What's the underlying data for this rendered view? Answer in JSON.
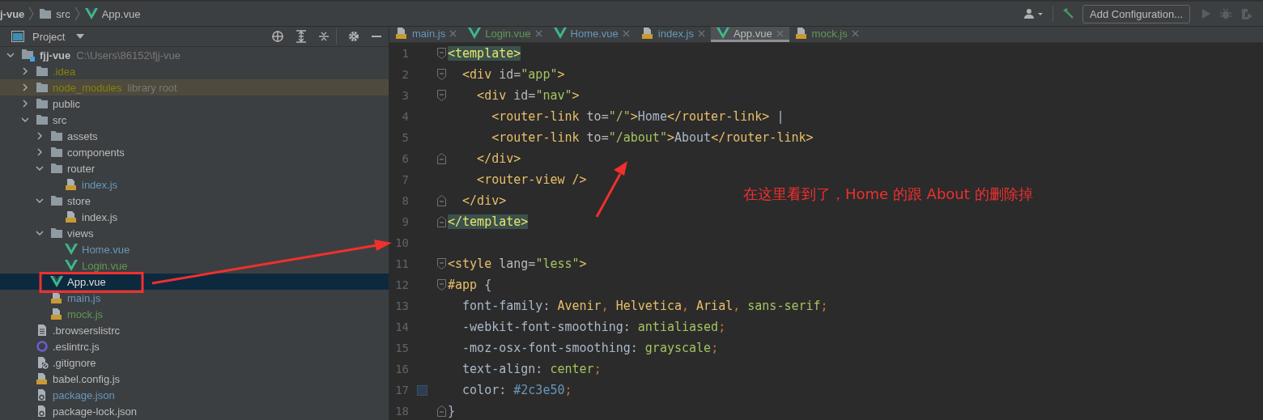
{
  "breadcrumb": [
    {
      "name": "j-vue",
      "kind": "project"
    },
    {
      "name": "src",
      "kind": "folder"
    },
    {
      "name": "App.vue",
      "kind": "vue"
    }
  ],
  "toolbar": {
    "run_configuration": "Add Configuration..."
  },
  "project_panel": {
    "title": "Project"
  },
  "tree": [
    {
      "name": "fjj-vue",
      "hint": "C:\\Users\\86152\\fjj-vue",
      "kind": "module",
      "color": "#bbbbbb",
      "selected": false,
      "library": false,
      "expanded": true,
      "children": [
        {
          "name": ".idea",
          "kind": "folder",
          "color": "#848504",
          "selected": false,
          "library": false,
          "expanded": false
        },
        {
          "name": "node_modules",
          "hint": "library root",
          "kind": "folder",
          "color": "#848504",
          "selected": false,
          "library": true,
          "expanded": false
        },
        {
          "name": "public",
          "kind": "folder",
          "color": "#bbbbbb",
          "selected": false,
          "library": false,
          "expanded": false
        },
        {
          "name": "src",
          "kind": "folder",
          "color": "#bbbbbb",
          "selected": false,
          "library": false,
          "expanded": true,
          "children": [
            {
              "name": "assets",
              "kind": "folder",
              "color": "#bbbbbb",
              "selected": false,
              "library": false,
              "expanded": false
            },
            {
              "name": "components",
              "kind": "folder",
              "color": "#bbbbbb",
              "selected": false,
              "library": false,
              "expanded": false
            },
            {
              "name": "router",
              "kind": "folder",
              "color": "#bbbbbb",
              "selected": false,
              "library": false,
              "expanded": true,
              "children": [
                {
                  "name": "index.js",
                  "kind": "js",
                  "color": "#6897bb",
                  "selected": false,
                  "library": false
                }
              ]
            },
            {
              "name": "store",
              "kind": "folder",
              "color": "#bbbbbb",
              "selected": false,
              "library": false,
              "expanded": true,
              "children": [
                {
                  "name": "index.js",
                  "kind": "js",
                  "color": "#bbbbbb",
                  "selected": false,
                  "library": false
                }
              ]
            },
            {
              "name": "views",
              "kind": "folder",
              "color": "#bbbbbb",
              "selected": false,
              "library": false,
              "expanded": true,
              "children": [
                {
                  "name": "Home.vue",
                  "kind": "vue",
                  "color": "#6897bb",
                  "selected": false,
                  "library": false
                },
                {
                  "name": "Login.vue",
                  "kind": "vue",
                  "color": "#629755",
                  "selected": false,
                  "library": false
                }
              ]
            },
            {
              "name": "App.vue",
              "kind": "vue",
              "color": "#dddddd",
              "selected": true,
              "library": false
            },
            {
              "name": "main.js",
              "kind": "js",
              "color": "#6897bb",
              "selected": false,
              "library": false
            },
            {
              "name": "mock.js",
              "kind": "js",
              "color": "#629755",
              "selected": false,
              "library": false
            }
          ]
        },
        {
          "name": ".browserslistrc",
          "kind": "text",
          "color": "#bbbbbb",
          "selected": false,
          "library": false
        },
        {
          "name": ".eslintrc.js",
          "kind": "eslint",
          "color": "#bbbbbb",
          "selected": false,
          "library": false
        },
        {
          "name": ".gitignore",
          "kind": "gitignore",
          "color": "#bbbbbb",
          "selected": false,
          "library": false
        },
        {
          "name": "babel.config.js",
          "kind": "js",
          "color": "#bbbbbb",
          "selected": false,
          "library": false
        },
        {
          "name": "package.json",
          "kind": "json",
          "color": "#6897bb",
          "selected": false,
          "library": false
        },
        {
          "name": "package-lock.json",
          "kind": "json",
          "color": "#bbbbbb",
          "selected": false,
          "library": false
        }
      ]
    }
  ],
  "tabs": [
    {
      "name": "main.js",
      "kind": "js",
      "color": "#6897bb",
      "selected": false
    },
    {
      "name": "Login.vue",
      "kind": "vue",
      "color": "#629755",
      "selected": false
    },
    {
      "name": "Home.vue",
      "kind": "vue",
      "color": "#6897bb",
      "selected": false
    },
    {
      "name": "index.js",
      "kind": "js",
      "color": "#6897bb",
      "selected": false
    },
    {
      "name": "App.vue",
      "kind": "vue",
      "color": "#bbbbbb",
      "selected": true
    },
    {
      "name": "mock.js",
      "kind": "js",
      "color": "#629755",
      "selected": false
    }
  ],
  "code": [
    {
      "number": "1",
      "kind": "fold-open",
      "tokens": [
        {
          "kind": "match",
          "t": "<template>"
        }
      ]
    },
    {
      "number": "2",
      "kind": "fold-open",
      "tokens": [
        {
          "kind": "tag",
          "t": "  <div"
        },
        {
          "kind": "attr",
          "t": " id="
        },
        {
          "kind": "string",
          "t": "\"app\""
        },
        {
          "kind": "tag",
          "t": ">"
        }
      ]
    },
    {
      "number": "3",
      "kind": "fold-open",
      "tokens": [
        {
          "kind": "tag",
          "t": "    <div"
        },
        {
          "kind": "attr",
          "t": " id="
        },
        {
          "kind": "string",
          "t": "\"nav\""
        },
        {
          "kind": "tag",
          "t": ">"
        }
      ]
    },
    {
      "number": "4",
      "kind": "plain",
      "tokens": [
        {
          "kind": "tag",
          "t": "      <router-link"
        },
        {
          "kind": "attr",
          "t": " to="
        },
        {
          "kind": "string",
          "t": "\"/\""
        },
        {
          "kind": "tag",
          "t": ">"
        },
        {
          "kind": "text",
          "t": "Home"
        },
        {
          "kind": "tag",
          "t": "</router-link>"
        },
        {
          "kind": "text",
          "t": " |"
        }
      ]
    },
    {
      "number": "5",
      "kind": "plain",
      "tokens": [
        {
          "kind": "tag",
          "t": "      <router-link"
        },
        {
          "kind": "attr",
          "t": " to="
        },
        {
          "kind": "string",
          "t": "\"/about\""
        },
        {
          "kind": "tag",
          "t": ">"
        },
        {
          "kind": "text",
          "t": "About"
        },
        {
          "kind": "tag",
          "t": "</router-link>"
        }
      ]
    },
    {
      "number": "6",
      "kind": "fold-close",
      "tokens": [
        {
          "kind": "tag",
          "t": "    </div>"
        }
      ]
    },
    {
      "number": "7",
      "kind": "plain",
      "tokens": [
        {
          "kind": "tag",
          "t": "    <router-view />"
        }
      ]
    },
    {
      "number": "8",
      "kind": "fold-close",
      "tokens": [
        {
          "kind": "tag",
          "t": "  </div>"
        }
      ]
    },
    {
      "number": "9",
      "kind": "fold-close",
      "tokens": [
        {
          "kind": "match",
          "t": "</template>"
        }
      ]
    },
    {
      "number": "10",
      "kind": "plain"
    },
    {
      "number": "11",
      "kind": "fold-open",
      "tokens": [
        {
          "kind": "tag",
          "t": "<style"
        },
        {
          "kind": "attr",
          "t": " lang="
        },
        {
          "kind": "string",
          "t": "\"less\""
        },
        {
          "kind": "tag",
          "t": ">"
        }
      ]
    },
    {
      "number": "12",
      "kind": "fold-open",
      "tokens": [
        {
          "kind": "selector",
          "t": "#app"
        },
        {
          "kind": "text",
          "t": " {"
        }
      ]
    },
    {
      "number": "13",
      "kind": "plain",
      "tokens": [
        {
          "kind": "prop",
          "t": "  font-family: "
        },
        {
          "kind": "value",
          "t": "Avenir"
        },
        {
          "kind": "punct",
          "t": ", "
        },
        {
          "kind": "value",
          "t": "Helvetica"
        },
        {
          "kind": "punct",
          "t": ", "
        },
        {
          "kind": "value",
          "t": "Arial"
        },
        {
          "kind": "punct",
          "t": ", "
        },
        {
          "kind": "keyword",
          "t": "sans-serif"
        },
        {
          "kind": "punct",
          "t": ";"
        }
      ]
    },
    {
      "number": "14",
      "kind": "plain",
      "tokens": [
        {
          "kind": "prop",
          "t": "  -webkit-font-smoothing: "
        },
        {
          "kind": "keyword",
          "t": "antialiased"
        },
        {
          "kind": "punct",
          "t": ";"
        }
      ]
    },
    {
      "number": "15",
      "kind": "plain",
      "tokens": [
        {
          "kind": "prop",
          "t": "  -moz-osx-font-smoothing: "
        },
        {
          "kind": "keyword",
          "t": "grayscale"
        },
        {
          "kind": "punct",
          "t": ";"
        }
      ]
    },
    {
      "number": "16",
      "kind": "plain",
      "tokens": [
        {
          "kind": "prop",
          "t": "  text-align: "
        },
        {
          "kind": "keyword",
          "t": "center"
        },
        {
          "kind": "punct",
          "t": ";"
        }
      ]
    },
    {
      "number": "17",
      "kind": "plain",
      "color": "#2c3e50",
      "tokens": [
        {
          "kind": "prop",
          "t": "  color: "
        },
        {
          "kind": "number",
          "t": "#2c3e50"
        },
        {
          "kind": "punct",
          "t": ";"
        }
      ]
    },
    {
      "number": "18",
      "kind": "fold-close",
      "tokens": [
        {
          "kind": "text",
          "t": "}"
        }
      ]
    }
  ],
  "annotation": {
    "note": "在这里看到了，Home 的跟 About 的删除掉"
  }
}
